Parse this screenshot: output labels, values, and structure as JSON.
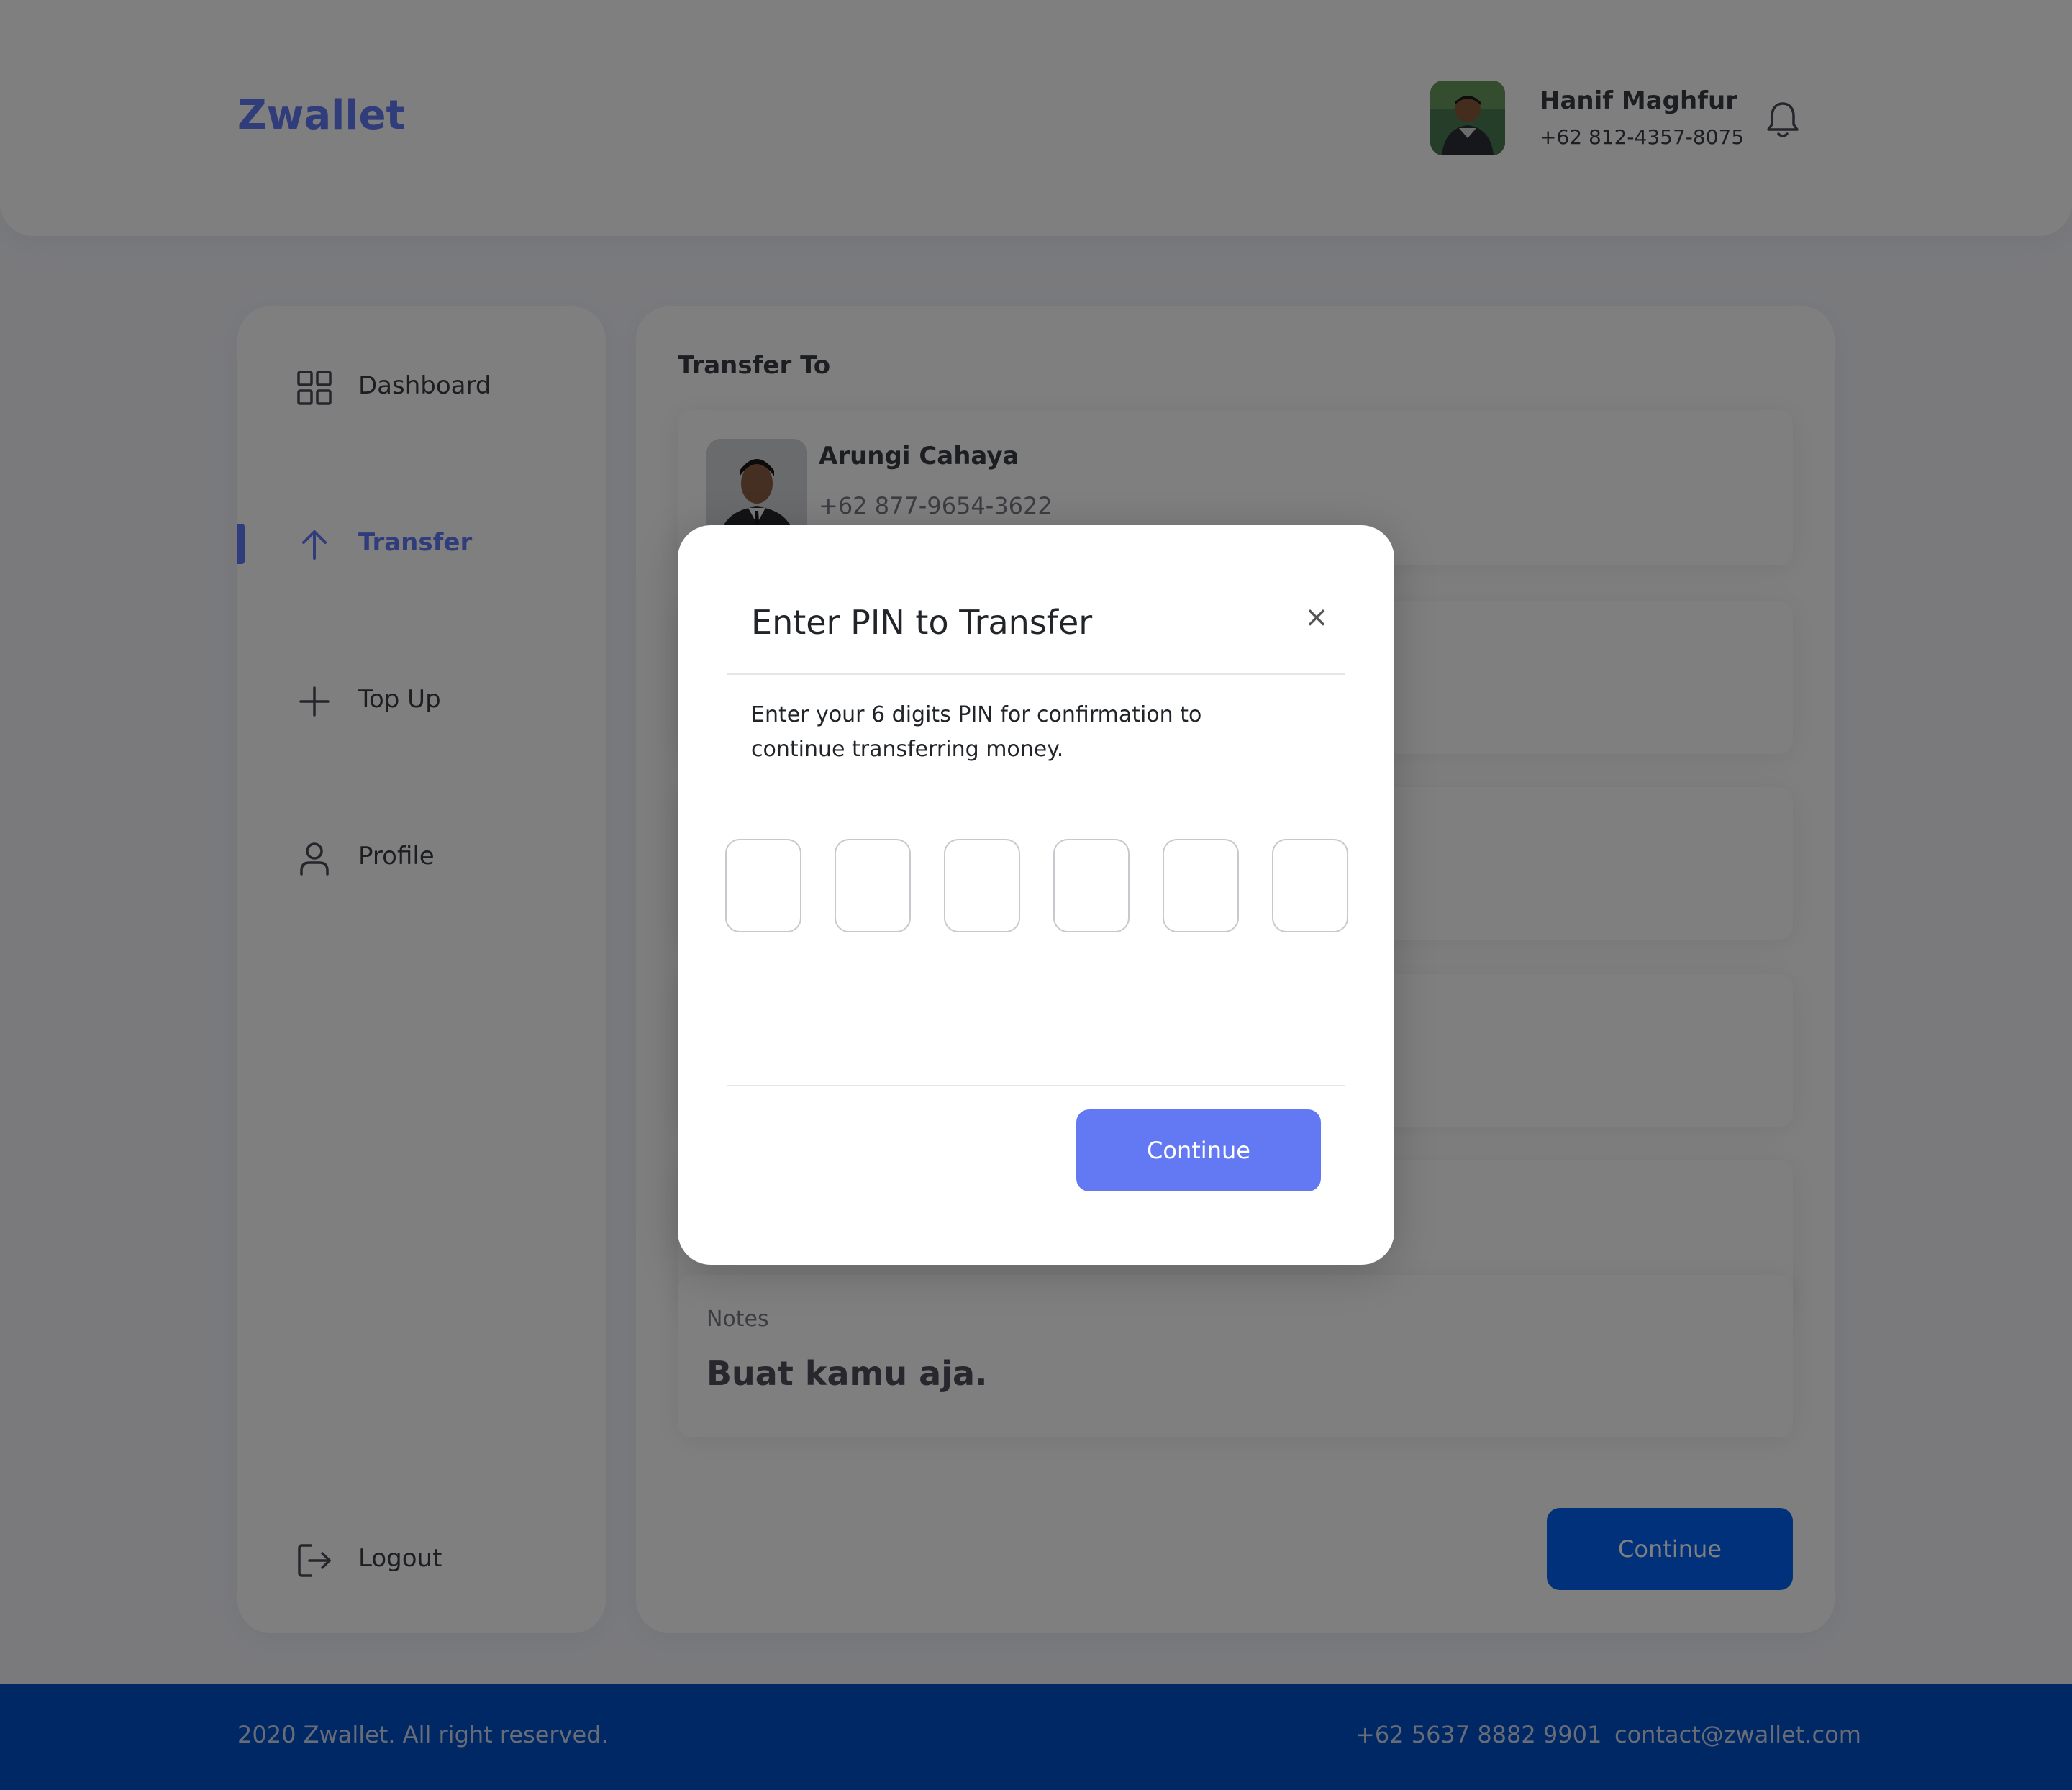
{
  "app": {
    "logo": "Zwallet"
  },
  "header": {
    "user_name": "Hanif Maghfur",
    "user_phone": "+62 812-4357-8075"
  },
  "sidebar": {
    "items": [
      {
        "label": "Dashboard",
        "icon": "grid-icon",
        "active": false
      },
      {
        "label": "Transfer",
        "icon": "arrow-up-icon",
        "active": true
      },
      {
        "label": "Top Up",
        "icon": "plus-icon",
        "active": false
      },
      {
        "label": "Profile",
        "icon": "user-icon",
        "active": false
      }
    ],
    "logout_label": "Logout"
  },
  "main": {
    "title": "Transfer To",
    "recipient": {
      "name": "Arungi Cahaya",
      "phone": "+62 877-9654-3622"
    },
    "notes": {
      "label": "Notes",
      "value": "Buat kamu aja."
    },
    "continue_label": "Continue"
  },
  "modal": {
    "title": "Enter PIN to Transfer",
    "close_symbol": "×",
    "description": "Enter your 6 digits PIN for confirmation to continue transferring money.",
    "pin_values": [
      "",
      "",
      "",
      "",
      "",
      ""
    ],
    "continue_label": "Continue"
  },
  "footer": {
    "copyright": "2020 Zwallet. All right reserved.",
    "phone": "+62 5637 8882 9901",
    "email": "contact@zwallet.com"
  },
  "colors": {
    "primary": "#6379f4",
    "footer": "#0050c8",
    "main_button": "#0062f5"
  }
}
